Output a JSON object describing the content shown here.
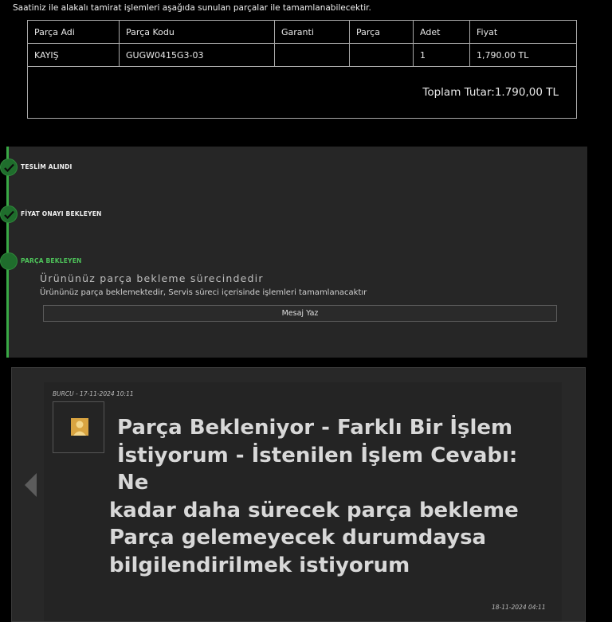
{
  "intro_text": "Saatiniz ile alakalı tamirat işlemleri aşağıda sunulan parçalar ile tamamlanabilecektir.",
  "parts_table": {
    "headers": [
      "Parça Adi",
      "Parça Kodu",
      "Garanti",
      "Parça",
      "Adet",
      "Fiyat"
    ],
    "rows": [
      {
        "name": "KAYIŞ",
        "code": "GUGW0415G3-03",
        "warranty": "",
        "part": "",
        "qty": "1",
        "price": "1,790.00 TL"
      }
    ],
    "total": "Toplam Tutar:1.790,00 TL"
  },
  "timeline": {
    "steps": [
      {
        "label": "TESLİM ALINDI",
        "state": "done"
      },
      {
        "label": "FİYAT ONAYI BEKLEYEN",
        "state": "done"
      },
      {
        "label": "PARÇA BEKLEYEN",
        "state": "active"
      }
    ],
    "status_title": "Ürününüz parça bekleme sürecindedir",
    "status_desc": "Ürününüz parça beklemektedir, Servis süreci içerisinde işlemleri tamamlanacaktır",
    "message_button": "Mesaj Yaz"
  },
  "message": {
    "author_date": "BURCU - 17-11-2024 10:11",
    "line1": "Parça Bekleniyor - Farklı Bir İşlem",
    "line2": "İstiyorum - İstenilen İşlem Cevabı: Ne",
    "line3": "kadar daha sürecek parça bekleme",
    "line4": "Parça gelemeyecek durumdaysa",
    "line5": "bilgilendirilmek istiyorum",
    "bottom_date": "18-11-2024 04:11"
  },
  "colors": {
    "accent": "#39a845",
    "panel": "#262626"
  }
}
